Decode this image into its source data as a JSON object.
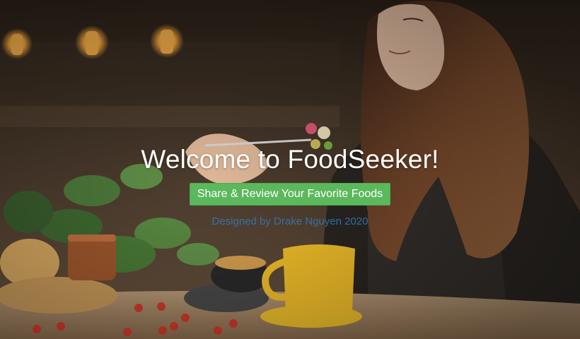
{
  "hero": {
    "title": "Welcome to FoodSeeker!",
    "cta_label": "Share & Review Your Favorite Foods",
    "credit": "Designed by Drake Nguyen 2020"
  },
  "colors": {
    "cta_background": "#5cb85c",
    "credit_text": "#337ab7",
    "title_text": "#ffffff"
  }
}
